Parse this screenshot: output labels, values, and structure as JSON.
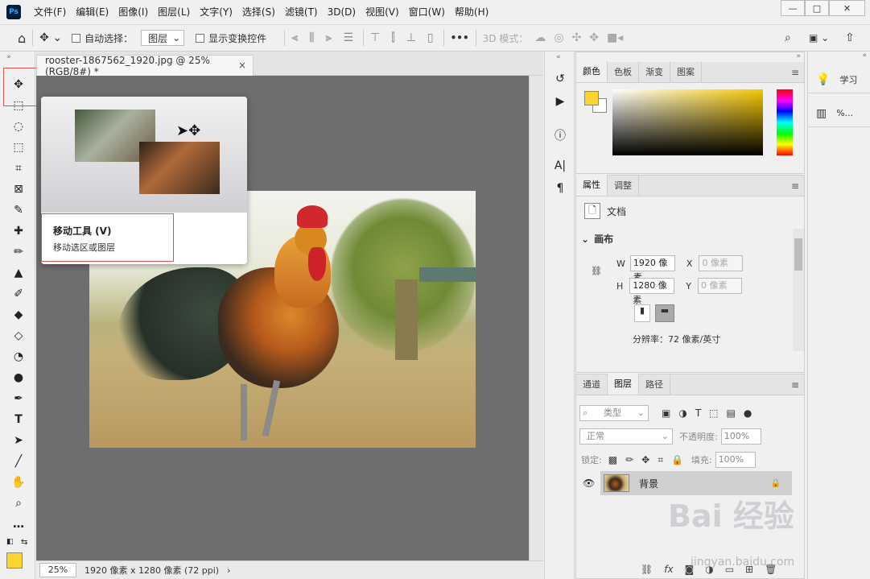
{
  "app": {
    "logo_text": "Ps"
  },
  "menu": [
    "文件(F)",
    "编辑(E)",
    "图像(I)",
    "图层(L)",
    "文字(Y)",
    "选择(S)",
    "滤镜(T)",
    "3D(D)",
    "视图(V)",
    "窗口(W)",
    "帮助(H)"
  ],
  "options": {
    "auto_select_label": "自动选择：",
    "auto_select_value": "图层",
    "show_transform_label": "显示变换控件",
    "more_label": "•••",
    "mode_3d_label": "3D 模式："
  },
  "document": {
    "tab_title": "rooster-1867562_1920.jpg @ 25%(RGB/8#) *",
    "tab_close": "×",
    "zoom": "25%",
    "status_info": "1920 像素 x 1280 像素 (72 ppi)",
    "status_arrow": "›"
  },
  "tooltip": {
    "title": "移动工具 (V)",
    "description": "移动选区或图层"
  },
  "color_panel": {
    "tabs": [
      "颜色",
      "色板",
      "渐变",
      "图案"
    ],
    "foreground": "#fcd42e",
    "background": "#ffffff"
  },
  "properties_panel": {
    "tabs": [
      "属性",
      "调整"
    ],
    "doc_label": "文档",
    "canvas_section": "画布",
    "w_label": "W",
    "w_value": "1920 像素",
    "h_label": "H",
    "h_value": "1280 像素",
    "x_label": "X",
    "x_placeholder": "0 像素",
    "y_label": "Y",
    "y_placeholder": "0 像素",
    "resolution": "分辨率：72 像素/英寸"
  },
  "layers_panel": {
    "tabs": [
      "通道",
      "图层",
      "路径"
    ],
    "filter_label": "类型",
    "blend_mode": "正常",
    "opacity_label": "不透明度:",
    "opacity_value": "100%",
    "lock_label": "锁定:",
    "fill_label": "填充:",
    "fill_value": "100%",
    "layer_name": "背景"
  },
  "learn_panel": {
    "learn_label": "学习",
    "percent_label": "%..."
  },
  "watermark": {
    "main": "Bai 经验",
    "url": "jingyan.baidu.com"
  }
}
